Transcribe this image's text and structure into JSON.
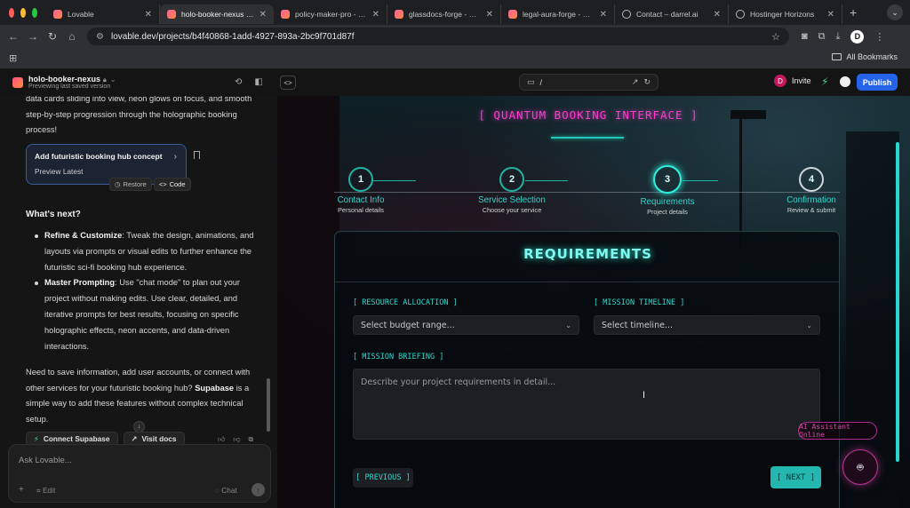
{
  "browser": {
    "tabs": [
      {
        "title": "Lovable",
        "icon": "lovable-heart",
        "active": false
      },
      {
        "title": "holo-booker-nexus - Lovable",
        "icon": "lovable-heart",
        "active": true
      },
      {
        "title": "policy-maker-pro - Lovable",
        "icon": "lovable-heart",
        "active": false
      },
      {
        "title": "glassdocs-forge - Lovable",
        "icon": "lovable-heart",
        "active": false
      },
      {
        "title": "legal-aura-forge - Lovable",
        "icon": "lovable-heart",
        "active": false
      },
      {
        "title": "Contact – darrel.ai",
        "icon": "globe",
        "active": false
      },
      {
        "title": "Hostinger Horizons",
        "icon": "globe",
        "active": false
      }
    ],
    "url": "lovable.dev/projects/b4f40868-1add-4927-893a-2bc9f701d87f",
    "profile_initial": "D",
    "all_bookmarks": "All Bookmarks",
    "colors": {
      "traffic_red": "#ff5f57",
      "traffic_yellow": "#febc2e",
      "traffic_green": "#28c840"
    }
  },
  "app": {
    "project_name": "holo-booker-nexus",
    "project_status": "Previewing last saved version",
    "preview_path": "/",
    "invite_label": "Invite",
    "invite_initial": "D",
    "publish_label": "Publish"
  },
  "chat": {
    "intro_text": "data cards sliding into view, neon glows on focus, and smooth step-by-step progression through the holographic booking process!",
    "version_card": {
      "title": "Add futuristic booking hub concept",
      "subtitle": "Preview Latest"
    },
    "restore_label": "Restore",
    "code_label": "Code",
    "whats_next": "What's next?",
    "bullets": [
      {
        "bold": "Refine & Customize",
        "text": ": Tweak the design, animations, and layouts via prompts or visual edits to further enhance the futuristic sci-fi booking hub experience."
      },
      {
        "bold": "Master Prompting",
        "text": ": Use \"chat mode\" to plan out your project without making edits. Use clear, detailed, and iterative prompts for best results, focusing on specific holographic effects, neon accents, and data-driven interactions."
      }
    ],
    "supabase_para": "Need to save information, add user accounts, or connect with other services for your futuristic booking hub?",
    "supabase_bold": "Supabase",
    "supabase_rest": " is a simple way to add these features without complex technical setup.",
    "connect_supabase": "Connect Supabase",
    "visit_docs": "Visit docs",
    "input_placeholder": "Ask Lovable...",
    "edit_label": "Edit",
    "chat_label": "Chat"
  },
  "preview": {
    "title": "[ QUANTUM BOOKING INTERFACE ]",
    "steps": [
      {
        "num": "1",
        "name": "Contact Info",
        "sub": "Personal details",
        "state": "done"
      },
      {
        "num": "2",
        "name": "Service Selection",
        "sub": "Choose your service",
        "state": "done"
      },
      {
        "num": "3",
        "name": "Requirements",
        "sub": "Project details",
        "state": "current"
      },
      {
        "num": "4",
        "name": "Confirmation",
        "sub": "Review & submit",
        "state": "todo"
      }
    ],
    "section_title": "REQUIREMENTS",
    "resource_label": "[ RESOURCE ALLOCATION ]",
    "resource_placeholder": "Select budget range...",
    "timeline_label": "[ MISSION TIMELINE ]",
    "timeline_placeholder": "Select timeline...",
    "briefing_label": "[ MISSION BRIEFING ]",
    "briefing_placeholder": "Describe your project requirements in detail...",
    "previous_label": "[ PREVIOUS ]",
    "next_label": "[ NEXT ]",
    "ai_status": "AI Assistant Online",
    "colors": {
      "neon_magenta": "#ff3bd0",
      "neon_cyan": "#2ef0dc",
      "button_teal": "#24b7b0"
    }
  }
}
